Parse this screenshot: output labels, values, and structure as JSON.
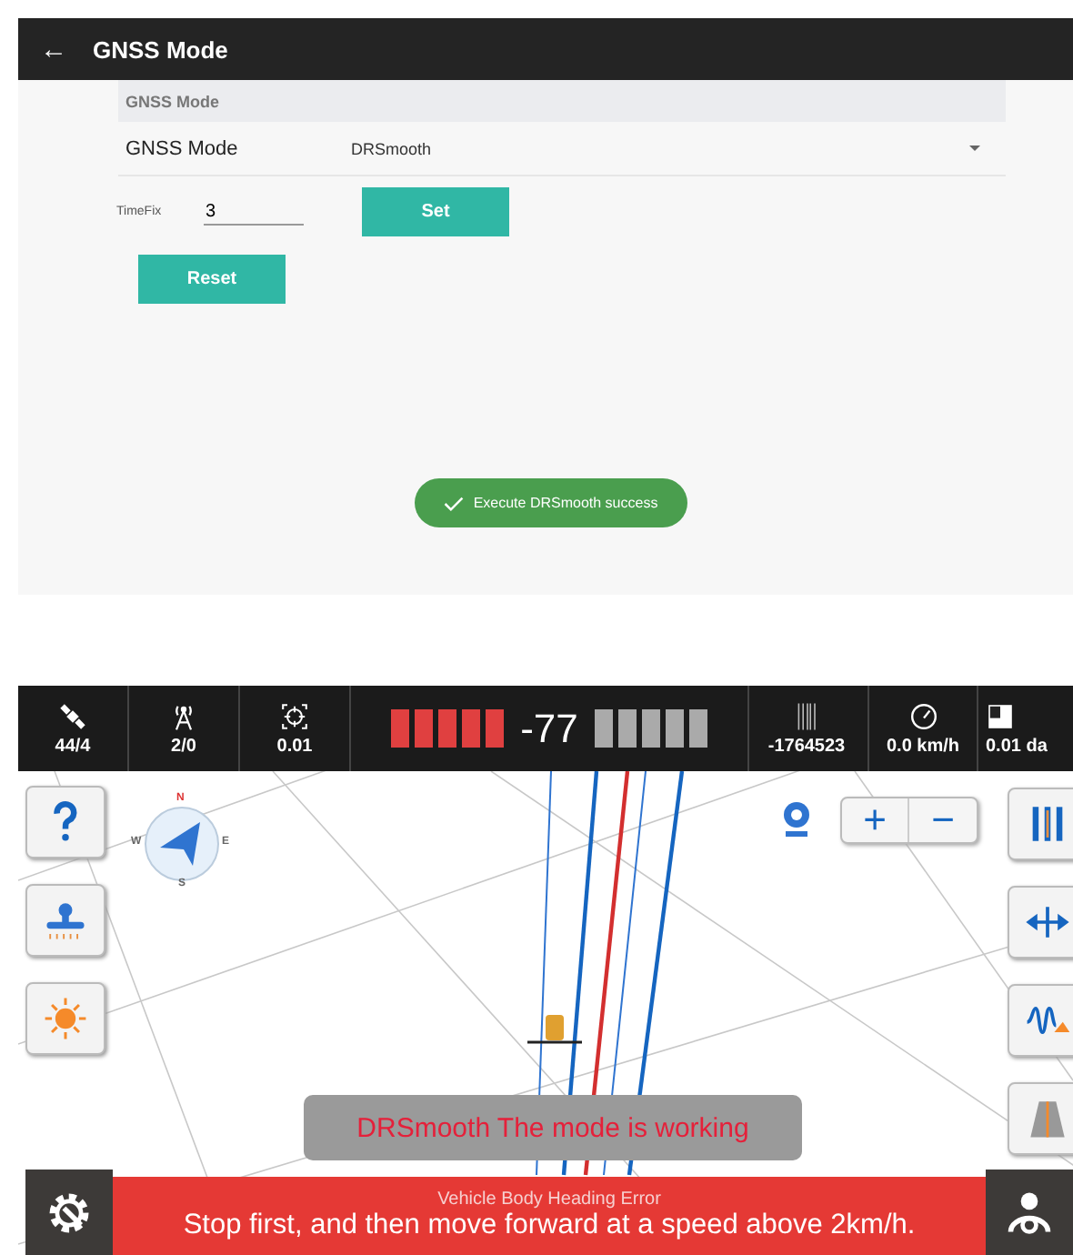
{
  "settings_screen": {
    "toolbar": {
      "back_icon": "←",
      "title": "GNSS Mode"
    },
    "section_header": "GNSS Mode",
    "mode_row": {
      "label": "GNSS Mode",
      "value": "DRSmooth"
    },
    "timefix": {
      "label": "TimeFix",
      "value": "3"
    },
    "buttons": [
      {
        "label": "Set"
      },
      {
        "label": "Reset"
      }
    ],
    "toast": "Execute DRSmooth success"
  },
  "guidance_screen": {
    "status_bar": [
      {
        "kind": "satellite",
        "value": "44/4"
      },
      {
        "kind": "antenna",
        "value": "2/0"
      },
      {
        "kind": "target",
        "value": "0.01"
      }
    ],
    "lightbar": {
      "reading": "-77",
      "left_segments": [
        {
          "on": true
        },
        {
          "on": true
        },
        {
          "on": true
        },
        {
          "on": true
        },
        {
          "on": true
        }
      ],
      "right_segments": [
        {
          "on": false
        },
        {
          "on": false
        },
        {
          "on": false
        },
        {
          "on": false
        },
        {
          "on": false
        }
      ]
    },
    "status_bar_right": [
      {
        "kind": "lines",
        "value": "-1764523"
      },
      {
        "kind": "speed",
        "value": "0.0 km/h"
      },
      {
        "kind": "area",
        "value": "0.01 da"
      }
    ],
    "compass": {
      "north": "N",
      "south": "S",
      "east": "E",
      "west": "W"
    },
    "zoom_controls": {
      "zoom_in": "+",
      "zoom_out": "−"
    },
    "left_tools": [
      {
        "kind": "help"
      },
      {
        "kind": "implement"
      },
      {
        "kind": "brightness"
      }
    ],
    "right_tools": [
      {
        "kind": "lines"
      },
      {
        "kind": "shift"
      },
      {
        "kind": "wave"
      },
      {
        "kind": "road"
      }
    ],
    "mode_message": "DRSmooth The mode is working",
    "alert": {
      "title": "Vehicle Body Heading Error",
      "message": "Stop first, and then move forward at a speed above 2km/h."
    }
  }
}
